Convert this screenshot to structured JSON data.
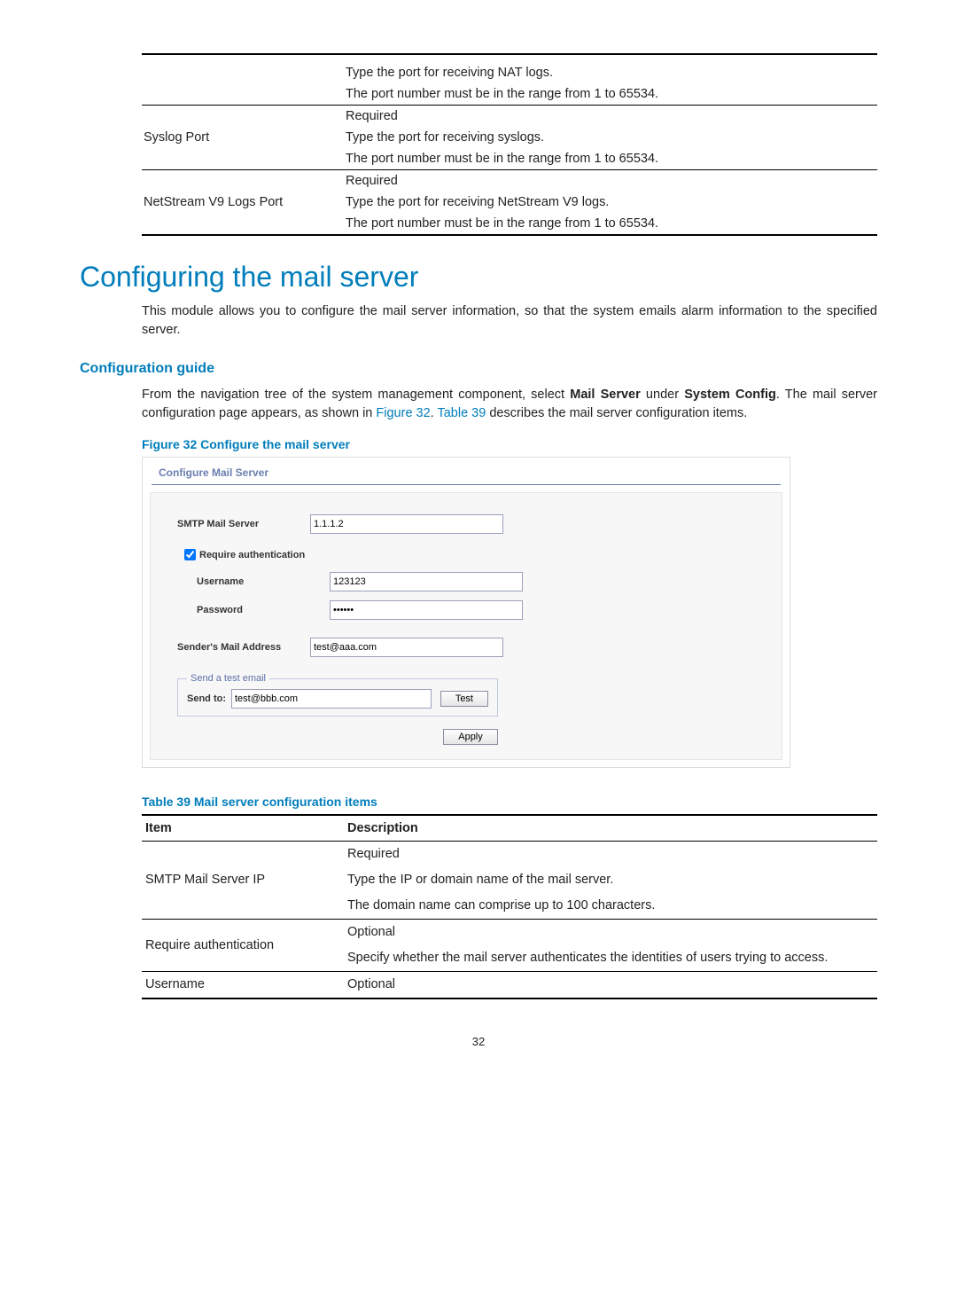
{
  "top_table": {
    "row1": {
      "desc_l1": "Type the port for receiving NAT logs.",
      "desc_l2": "The port number must be in the range from 1 to 65534."
    },
    "row2": {
      "item": "Syslog Port",
      "d1": "Required",
      "d2": "Type the port for receiving syslogs.",
      "d3": "The port number must be in the range from 1 to 65534."
    },
    "row3": {
      "item": "NetStream V9 Logs Port",
      "d1": "Required",
      "d2": "Type the port for receiving NetStream V9 logs.",
      "d3": "The port number must be in the range from 1 to 65534."
    }
  },
  "section_title": "Configuring the mail server",
  "intro_para": "This module allows you to configure the mail server information, so that the system emails alarm information to the specified server.",
  "guide_heading": "Configuration guide",
  "guide_para_pre": "From the navigation tree of the system management component, select ",
  "guide_para_mail": "Mail Server",
  "guide_para_mid": " under ",
  "guide_para_sys": "System Config",
  "guide_para_post1": ". The mail server configuration page appears, as shown in ",
  "fig_link": "Figure 32",
  "guide_para_post2": ". ",
  "tbl_link": "Table 39",
  "guide_para_post3": " describes the mail server configuration items.",
  "figure_caption": "Figure 32 Configure the mail server",
  "shot": {
    "title": "Configure Mail Server",
    "smtp_label": "SMTP Mail Server",
    "smtp_value": "1.1.1.2",
    "req_auth_label": "Require authentication",
    "req_auth_checked": true,
    "user_label": "Username",
    "user_value": "123123",
    "pass_label": "Password",
    "pass_value": "••••••",
    "sender_label": "Sender's Mail Address",
    "sender_value": "test@aaa.com",
    "fieldset_legend": "Send a test email",
    "sendto_label": "Send to:",
    "sendto_value": "test@bbb.com",
    "test_btn": "Test",
    "apply_btn": "Apply"
  },
  "table_caption": "Table 39 Mail server configuration items",
  "desc_table": {
    "h_item": "Item",
    "h_desc": "Description",
    "r1": {
      "item": "SMTP Mail Server IP",
      "d1": "Required",
      "d2": "Type the IP or domain name of the mail server.",
      "d3": "The domain name can comprise up to 100 characters."
    },
    "r2": {
      "item": "Require authentication",
      "d1": "Optional",
      "d2": "Specify whether the mail server authenticates the identities of users trying to access."
    },
    "r3": {
      "item": "Username",
      "d1": "Optional"
    }
  },
  "page_number": "32"
}
